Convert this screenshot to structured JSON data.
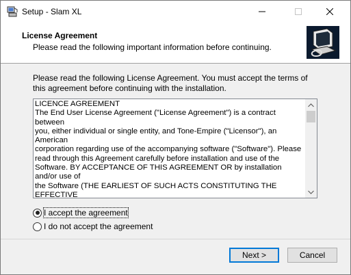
{
  "window": {
    "title": "Setup - Slam XL",
    "controls": {
      "minimize_icon": "minimize-icon",
      "maximize_icon": "maximize-icon",
      "close_icon": "close-icon"
    }
  },
  "header": {
    "title": "License Agreement",
    "subtitle": "Please read the following important information before continuing."
  },
  "intro_text": "Please read the following License Agreement. You must accept the terms of this agreement before continuing with the installation.",
  "license": {
    "text": "LICENCE AGREEMENT\nThe End User License Agreement (\"License Agreement\") is a contract between\nyou, either individual or single entity, and Tone-Empire (\"Licensor\"), an American\ncorporation regarding use of the accompanying software (\"Software\"). Please\nread through this Agreement carefully before installation and use of the\nSoftware. BY ACCEPTANCE OF THIS AGREEMENT OR by installation and/or use of\nthe Software (THE EARLIEST OF SUCH ACTS CONSTITUTING THE EFFECTIVE\nDATE OF THIS AGREEMENT), you agree to be bound by the terms and conditions\nof this Agreement. Should you not accept the terms and conditions set forth in\nthis Agree- ment, do not install the Software and delete the Software from\nyour computer and any copies thereof."
  },
  "options": {
    "accept_label": "I accept the agreement",
    "decline_label": "I do not accept the agreement",
    "selected": "accept"
  },
  "buttons": {
    "next_label": "Next >",
    "cancel_label": "Cancel"
  }
}
